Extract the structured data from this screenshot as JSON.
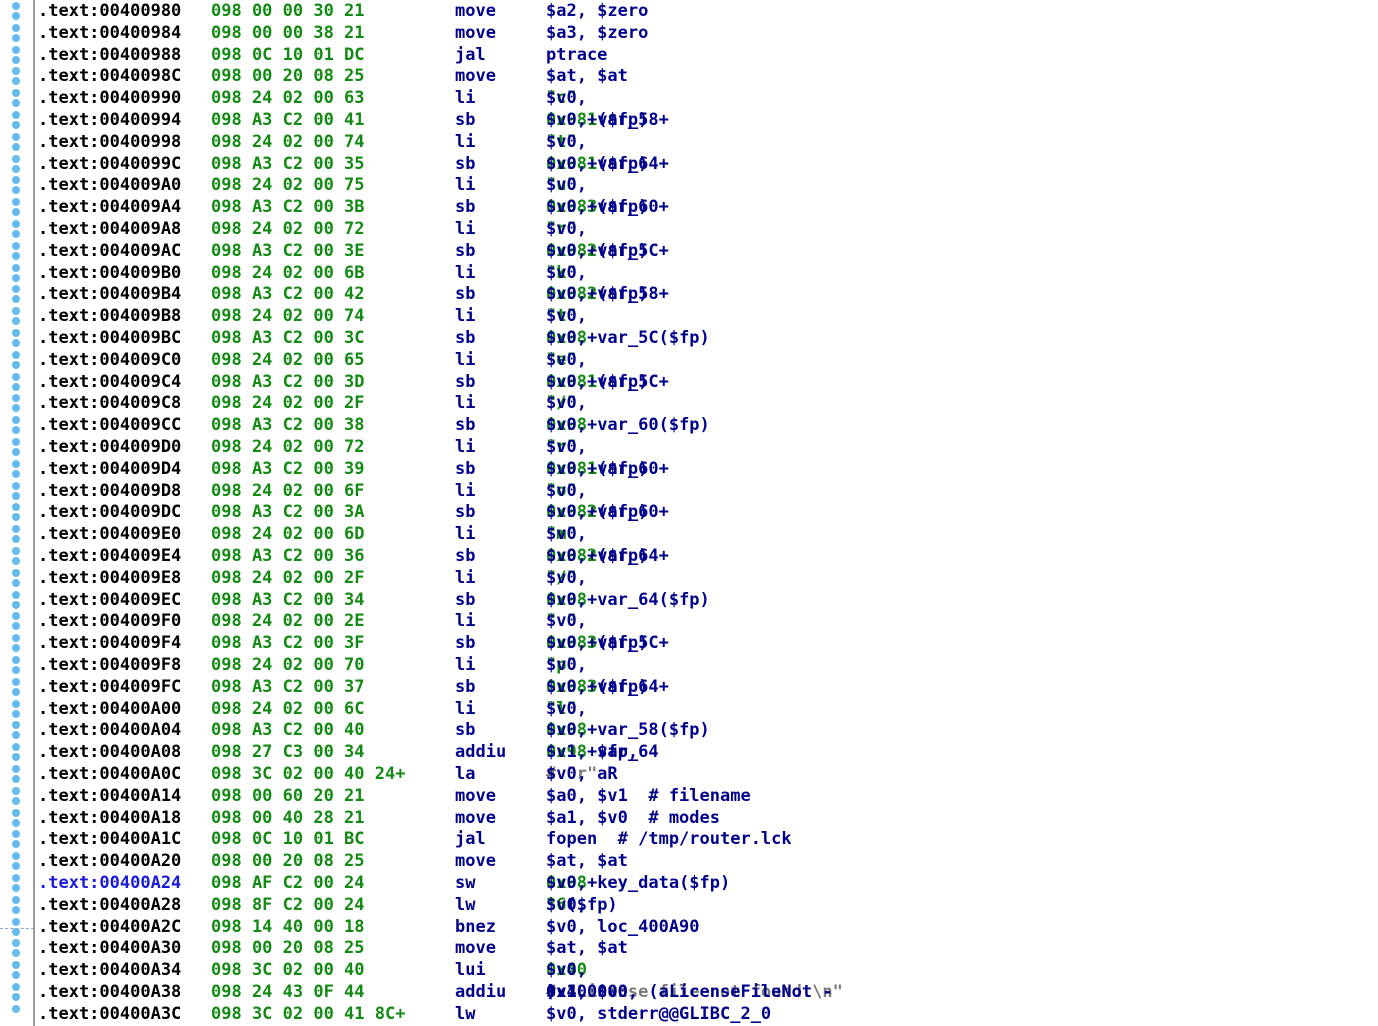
{
  "gutter": {
    "dot_color": "#66bbee"
  },
  "colors": {
    "address": "#000000",
    "address_highlight": "#1a1adc",
    "bytes": "#138a13",
    "mnemonic": "#00008b",
    "operand": "#00008b",
    "comment": "#7a7a7a"
  },
  "lines": [
    {
      "addr": ".text:00400980",
      "bytes": "098 00 00 30 21",
      "mnemonic": "move",
      "operands": [
        {
          "t": "$a2, $zero",
          "c": "o"
        }
      ]
    },
    {
      "addr": ".text:00400984",
      "bytes": "098 00 00 38 21",
      "mnemonic": "move",
      "operands": [
        {
          "t": "$a3, $zero",
          "c": "o"
        }
      ]
    },
    {
      "addr": ".text:00400988",
      "bytes": "098 0C 10 01 DC",
      "mnemonic": "jal",
      "operands": [
        {
          "t": "ptrace",
          "c": "o"
        }
      ]
    },
    {
      "addr": ".text:0040098C",
      "bytes": "098 00 20 08 25",
      "mnemonic": "move",
      "operands": [
        {
          "t": "$at, $at",
          "c": "o"
        }
      ]
    },
    {
      "addr": ".text:00400990",
      "bytes": "098 24 02 00 63",
      "mnemonic": "li",
      "operands": [
        {
          "t": "$v0, ",
          "c": "o"
        },
        {
          "t": "\"c\"",
          "c": "g"
        }
      ]
    },
    {
      "addr": ".text:00400994",
      "bytes": "098 A3 C2 00 41",
      "mnemonic": "sb",
      "operands": [
        {
          "t": "$v0, ",
          "c": "o"
        },
        {
          "t": "0x98",
          "c": "g"
        },
        {
          "t": "+var_58+",
          "c": "o"
        },
        {
          "t": "1",
          "c": "g"
        },
        {
          "t": "($fp)",
          "c": "o"
        }
      ]
    },
    {
      "addr": ".text:00400998",
      "bytes": "098 24 02 00 74",
      "mnemonic": "li",
      "operands": [
        {
          "t": "$v0, ",
          "c": "o"
        },
        {
          "t": "\"t\"",
          "c": "g"
        }
      ]
    },
    {
      "addr": ".text:0040099C",
      "bytes": "098 A3 C2 00 35",
      "mnemonic": "sb",
      "operands": [
        {
          "t": "$v0, ",
          "c": "o"
        },
        {
          "t": "0x98",
          "c": "g"
        },
        {
          "t": "+var_64+",
          "c": "o"
        },
        {
          "t": "1",
          "c": "g"
        },
        {
          "t": "($fp)",
          "c": "o"
        }
      ]
    },
    {
      "addr": ".text:004009A0",
      "bytes": "098 24 02 00 75",
      "mnemonic": "li",
      "operands": [
        {
          "t": "$v0, ",
          "c": "o"
        },
        {
          "t": "\"u\"",
          "c": "g"
        }
      ]
    },
    {
      "addr": ".text:004009A4",
      "bytes": "098 A3 C2 00 3B",
      "mnemonic": "sb",
      "operands": [
        {
          "t": "$v0, ",
          "c": "o"
        },
        {
          "t": "0x98",
          "c": "g"
        },
        {
          "t": "+var_60+",
          "c": "o"
        },
        {
          "t": "3",
          "c": "g"
        },
        {
          "t": "($fp)",
          "c": "o"
        }
      ]
    },
    {
      "addr": ".text:004009A8",
      "bytes": "098 24 02 00 72",
      "mnemonic": "li",
      "operands": [
        {
          "t": "$v0, ",
          "c": "o"
        },
        {
          "t": "\"r\"",
          "c": "g"
        }
      ]
    },
    {
      "addr": ".text:004009AC",
      "bytes": "098 A3 C2 00 3E",
      "mnemonic": "sb",
      "operands": [
        {
          "t": "$v0, ",
          "c": "o"
        },
        {
          "t": "0x98",
          "c": "g"
        },
        {
          "t": "+var_5C+",
          "c": "o"
        },
        {
          "t": "2",
          "c": "g"
        },
        {
          "t": "($fp)",
          "c": "o"
        }
      ]
    },
    {
      "addr": ".text:004009B0",
      "bytes": "098 24 02 00 6B",
      "mnemonic": "li",
      "operands": [
        {
          "t": "$v0, ",
          "c": "o"
        },
        {
          "t": "\"k\"",
          "c": "g"
        }
      ]
    },
    {
      "addr": ".text:004009B4",
      "bytes": "098 A3 C2 00 42",
      "mnemonic": "sb",
      "operands": [
        {
          "t": "$v0, ",
          "c": "o"
        },
        {
          "t": "0x98",
          "c": "g"
        },
        {
          "t": "+var_58+",
          "c": "o"
        },
        {
          "t": "2",
          "c": "g"
        },
        {
          "t": "($fp)",
          "c": "o"
        }
      ]
    },
    {
      "addr": ".text:004009B8",
      "bytes": "098 24 02 00 74",
      "mnemonic": "li",
      "operands": [
        {
          "t": "$v0, ",
          "c": "o"
        },
        {
          "t": "\"t\"",
          "c": "g"
        }
      ]
    },
    {
      "addr": ".text:004009BC",
      "bytes": "098 A3 C2 00 3C",
      "mnemonic": "sb",
      "operands": [
        {
          "t": "$v0, ",
          "c": "o"
        },
        {
          "t": "0x98",
          "c": "g"
        },
        {
          "t": "+var_5C($fp)",
          "c": "o"
        }
      ]
    },
    {
      "addr": ".text:004009C0",
      "bytes": "098 24 02 00 65",
      "mnemonic": "li",
      "operands": [
        {
          "t": "$v0, ",
          "c": "o"
        },
        {
          "t": "\"e\"",
          "c": "g"
        }
      ]
    },
    {
      "addr": ".text:004009C4",
      "bytes": "098 A3 C2 00 3D",
      "mnemonic": "sb",
      "operands": [
        {
          "t": "$v0, ",
          "c": "o"
        },
        {
          "t": "0x98",
          "c": "g"
        },
        {
          "t": "+var_5C+",
          "c": "o"
        },
        {
          "t": "1",
          "c": "g"
        },
        {
          "t": "($fp)",
          "c": "o"
        }
      ]
    },
    {
      "addr": ".text:004009C8",
      "bytes": "098 24 02 00 2F",
      "mnemonic": "li",
      "operands": [
        {
          "t": "$v0, ",
          "c": "o"
        },
        {
          "t": "\"/\"",
          "c": "g"
        }
      ]
    },
    {
      "addr": ".text:004009CC",
      "bytes": "098 A3 C2 00 38",
      "mnemonic": "sb",
      "operands": [
        {
          "t": "$v0, ",
          "c": "o"
        },
        {
          "t": "0x98",
          "c": "g"
        },
        {
          "t": "+var_60($fp)",
          "c": "o"
        }
      ]
    },
    {
      "addr": ".text:004009D0",
      "bytes": "098 24 02 00 72",
      "mnemonic": "li",
      "operands": [
        {
          "t": "$v0, ",
          "c": "o"
        },
        {
          "t": "\"r\"",
          "c": "g"
        }
      ]
    },
    {
      "addr": ".text:004009D4",
      "bytes": "098 A3 C2 00 39",
      "mnemonic": "sb",
      "operands": [
        {
          "t": "$v0, ",
          "c": "o"
        },
        {
          "t": "0x98",
          "c": "g"
        },
        {
          "t": "+var_60+",
          "c": "o"
        },
        {
          "t": "1",
          "c": "g"
        },
        {
          "t": "($fp)",
          "c": "o"
        }
      ]
    },
    {
      "addr": ".text:004009D8",
      "bytes": "098 24 02 00 6F",
      "mnemonic": "li",
      "operands": [
        {
          "t": "$v0, ",
          "c": "o"
        },
        {
          "t": "\"o\"",
          "c": "g"
        }
      ]
    },
    {
      "addr": ".text:004009DC",
      "bytes": "098 A3 C2 00 3A",
      "mnemonic": "sb",
      "operands": [
        {
          "t": "$v0, ",
          "c": "o"
        },
        {
          "t": "0x98",
          "c": "g"
        },
        {
          "t": "+var_60+",
          "c": "o"
        },
        {
          "t": "2",
          "c": "g"
        },
        {
          "t": "($fp)",
          "c": "o"
        }
      ]
    },
    {
      "addr": ".text:004009E0",
      "bytes": "098 24 02 00 6D",
      "mnemonic": "li",
      "operands": [
        {
          "t": "$v0, ",
          "c": "o"
        },
        {
          "t": "\"m\"",
          "c": "g"
        }
      ]
    },
    {
      "addr": ".text:004009E4",
      "bytes": "098 A3 C2 00 36",
      "mnemonic": "sb",
      "operands": [
        {
          "t": "$v0, ",
          "c": "o"
        },
        {
          "t": "0x98",
          "c": "g"
        },
        {
          "t": "+var_64+",
          "c": "o"
        },
        {
          "t": "2",
          "c": "g"
        },
        {
          "t": "($fp)",
          "c": "o"
        }
      ]
    },
    {
      "addr": ".text:004009E8",
      "bytes": "098 24 02 00 2F",
      "mnemonic": "li",
      "operands": [
        {
          "t": "$v0, ",
          "c": "o"
        },
        {
          "t": "\"/\"",
          "c": "g"
        }
      ]
    },
    {
      "addr": ".text:004009EC",
      "bytes": "098 A3 C2 00 34",
      "mnemonic": "sb",
      "operands": [
        {
          "t": "$v0, ",
          "c": "o"
        },
        {
          "t": "0x98",
          "c": "g"
        },
        {
          "t": "+var_64($fp)",
          "c": "o"
        }
      ]
    },
    {
      "addr": ".text:004009F0",
      "bytes": "098 24 02 00 2E",
      "mnemonic": "li",
      "operands": [
        {
          "t": "$v0, ",
          "c": "o"
        },
        {
          "t": "\".\"",
          "c": "g"
        }
      ]
    },
    {
      "addr": ".text:004009F4",
      "bytes": "098 A3 C2 00 3F",
      "mnemonic": "sb",
      "operands": [
        {
          "t": "$v0, ",
          "c": "o"
        },
        {
          "t": "0x98",
          "c": "g"
        },
        {
          "t": "+var_5C+",
          "c": "o"
        },
        {
          "t": "3",
          "c": "g"
        },
        {
          "t": "($fp)",
          "c": "o"
        }
      ]
    },
    {
      "addr": ".text:004009F8",
      "bytes": "098 24 02 00 70",
      "mnemonic": "li",
      "operands": [
        {
          "t": "$v0, ",
          "c": "o"
        },
        {
          "t": "\"p\"",
          "c": "g"
        }
      ]
    },
    {
      "addr": ".text:004009FC",
      "bytes": "098 A3 C2 00 37",
      "mnemonic": "sb",
      "operands": [
        {
          "t": "$v0, ",
          "c": "o"
        },
        {
          "t": "0x98",
          "c": "g"
        },
        {
          "t": "+var_64+",
          "c": "o"
        },
        {
          "t": "3",
          "c": "g"
        },
        {
          "t": "($fp)",
          "c": "o"
        }
      ]
    },
    {
      "addr": ".text:00400A00",
      "bytes": "098 24 02 00 6C",
      "mnemonic": "li",
      "operands": [
        {
          "t": "$v0, ",
          "c": "o"
        },
        {
          "t": "\"l\"",
          "c": "g"
        }
      ]
    },
    {
      "addr": ".text:00400A04",
      "bytes": "098 A3 C2 00 40",
      "mnemonic": "sb",
      "operands": [
        {
          "t": "$v0, ",
          "c": "o"
        },
        {
          "t": "0x98",
          "c": "g"
        },
        {
          "t": "+var_58($fp)",
          "c": "o"
        }
      ]
    },
    {
      "addr": ".text:00400A08",
      "bytes": "098 27 C3 00 34",
      "mnemonic": "addiu",
      "operands": [
        {
          "t": "$v1, $fp, ",
          "c": "o"
        },
        {
          "t": "0x98",
          "c": "g"
        },
        {
          "t": "+var_64",
          "c": "o"
        }
      ]
    },
    {
      "addr": ".text:00400A0C",
      "bytes": "098 3C 02 00 40 24+",
      "mnemonic": "la",
      "operands": [
        {
          "t": "$v0, aR  ",
          "c": "o"
        },
        {
          "t": "# \"r\"",
          "c": "c"
        }
      ]
    },
    {
      "addr": ".text:00400A14",
      "bytes": "098 00 60 20 21",
      "mnemonic": "move",
      "operands": [
        {
          "t": "$a0, $v1  # filename",
          "c": "o"
        }
      ]
    },
    {
      "addr": ".text:00400A18",
      "bytes": "098 00 40 28 21",
      "mnemonic": "move",
      "operands": [
        {
          "t": "$a1, $v0  # modes",
          "c": "o"
        }
      ]
    },
    {
      "addr": ".text:00400A1C",
      "bytes": "098 0C 10 01 BC",
      "mnemonic": "jal",
      "operands": [
        {
          "t": "fopen  # /tmp/router.lck",
          "c": "o"
        }
      ]
    },
    {
      "addr": ".text:00400A20",
      "bytes": "098 00 20 08 25",
      "mnemonic": "move",
      "operands": [
        {
          "t": "$at, $at",
          "c": "o"
        }
      ]
    },
    {
      "addr": ".text:00400A24",
      "bytes": "098 AF C2 00 24",
      "mnemonic": "sw",
      "hl": true,
      "operands": [
        {
          "t": "$v0, ",
          "c": "o"
        },
        {
          "t": "0x98",
          "c": "g"
        },
        {
          "t": "+key_data($fp)",
          "c": "o"
        }
      ]
    },
    {
      "addr": ".text:00400A28",
      "bytes": "098 8F C2 00 24",
      "mnemonic": "lw",
      "operands": [
        {
          "t": "$v0, ",
          "c": "o"
        },
        {
          "t": "36",
          "c": "g"
        },
        {
          "t": "($fp)",
          "c": "o"
        }
      ]
    },
    {
      "addr": ".text:00400A2C",
      "bytes": "098 14 40 00 18",
      "mnemonic": "bnez",
      "operands": [
        {
          "t": "$v0, loc_400A90",
          "c": "o"
        }
      ]
    },
    {
      "addr": ".text:00400A30",
      "bytes": "098 00 20 08 25",
      "mnemonic": "move",
      "operands": [
        {
          "t": "$at, $at",
          "c": "o"
        }
      ]
    },
    {
      "addr": ".text:00400A34",
      "bytes": "098 3C 02 00 40",
      "mnemonic": "lui",
      "operands": [
        {
          "t": "$v0, ",
          "c": "o"
        },
        {
          "t": "0x40",
          "c": "g"
        }
      ]
    },
    {
      "addr": ".text:00400A38",
      "bytes": "098 24 43 0F 44",
      "mnemonic": "addiu",
      "operands": [
        {
          "t": "$v1, $v0, (aLicenseFileNot - ",
          "c": "o"
        },
        {
          "t": "0x400000",
          "c": "o"
        },
        {
          "t": ")  ",
          "c": "o"
        },
        {
          "t": "# \"License file not found.\\n\"",
          "c": "c"
        }
      ]
    },
    {
      "addr": ".text:00400A3C",
      "bytes": "098 3C 02 00 41 8C+",
      "mnemonic": "lw",
      "operands": [
        {
          "t": "$v0, stderr@@GLIBC_2_0",
          "c": "o"
        }
      ]
    }
  ]
}
